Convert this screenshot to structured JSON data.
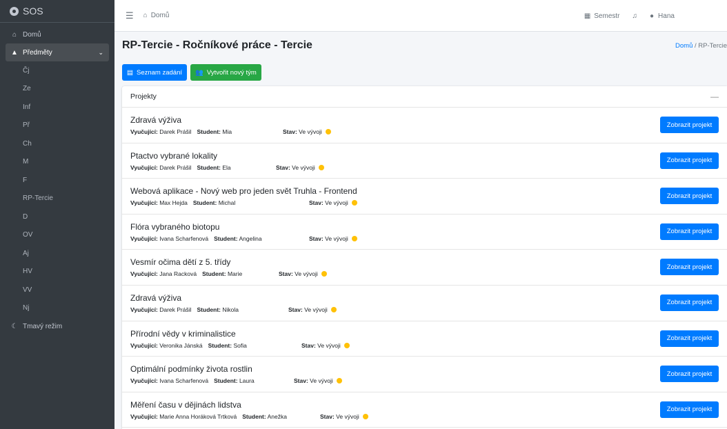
{
  "sidebar": {
    "brand": "SOS",
    "home": "Domů",
    "subjects": "Předměty",
    "items": [
      "Čj",
      "Ze",
      "Inf",
      "Př",
      "Ch",
      "M",
      "F",
      "RP-Tercie",
      "D",
      "OV",
      "Aj",
      "HV",
      "VV",
      "Nj"
    ],
    "dark_mode": "Tmavý režim"
  },
  "topbar": {
    "home": "Domů",
    "semester": "Semestr",
    "user": "Hana"
  },
  "page": {
    "title": "RP-Tercie - Ročníkové práce - Tercie",
    "breadcrumb_home": "Domů",
    "breadcrumb_sep": "/",
    "breadcrumb_current": "RP-Tercie"
  },
  "actions": {
    "list_label": "Seznam zadání",
    "create_label": "Vytvořit nový tým"
  },
  "card": {
    "title": "Projekty",
    "collapse": "—"
  },
  "labels": {
    "teacher": "Vyučující:",
    "student": "Student:",
    "status": "Stav:",
    "show": "Zobrazit projekt"
  },
  "projects": [
    {
      "title": "Zdravá výživa",
      "teacher": "Darek Prášil",
      "student": "Mia",
      "status": "Ve vývoji"
    },
    {
      "title": "Ptactvo vybrané lokality",
      "teacher": "Darek Prášil",
      "student": "Ela",
      "status": "Ve vývoji"
    },
    {
      "title": "Webová aplikace - Nový web pro jeden svět Truhla - Frontend",
      "teacher": "Max Hejda",
      "student": "Michal",
      "status": "Ve vývoji"
    },
    {
      "title": "Flóra vybraného biotopu",
      "teacher": "Ivana Scharfenová",
      "student": "Angelina",
      "status": "Ve vývoji"
    },
    {
      "title": "Vesmír očima dětí z 5. třídy",
      "teacher": "Jana Racková",
      "student": "Marie",
      "status": "Ve vývoji"
    },
    {
      "title": "Zdravá výživa",
      "teacher": "Darek Prášil",
      "student": "Nikola",
      "status": "Ve vývoji"
    },
    {
      "title": "Přírodní vědy v kriminalistice",
      "teacher": "Veronika Jánská",
      "student": "Sofia",
      "status": "Ve vývoji"
    },
    {
      "title": "Optimální podmínky života rostlin",
      "teacher": "Ivana Scharfenová",
      "student": "Laura",
      "status": "Ve vývoji"
    },
    {
      "title": "Měření času v dějinách lidstva",
      "teacher": "Marie Anna Horáková Trtková",
      "student": "Anežka",
      "status": "Ve vývoji"
    }
  ],
  "colors": {
    "sidebar_bg": "#343a40",
    "primary": "#007bff",
    "success": "#28a745",
    "status_dot": "#ffc107"
  }
}
